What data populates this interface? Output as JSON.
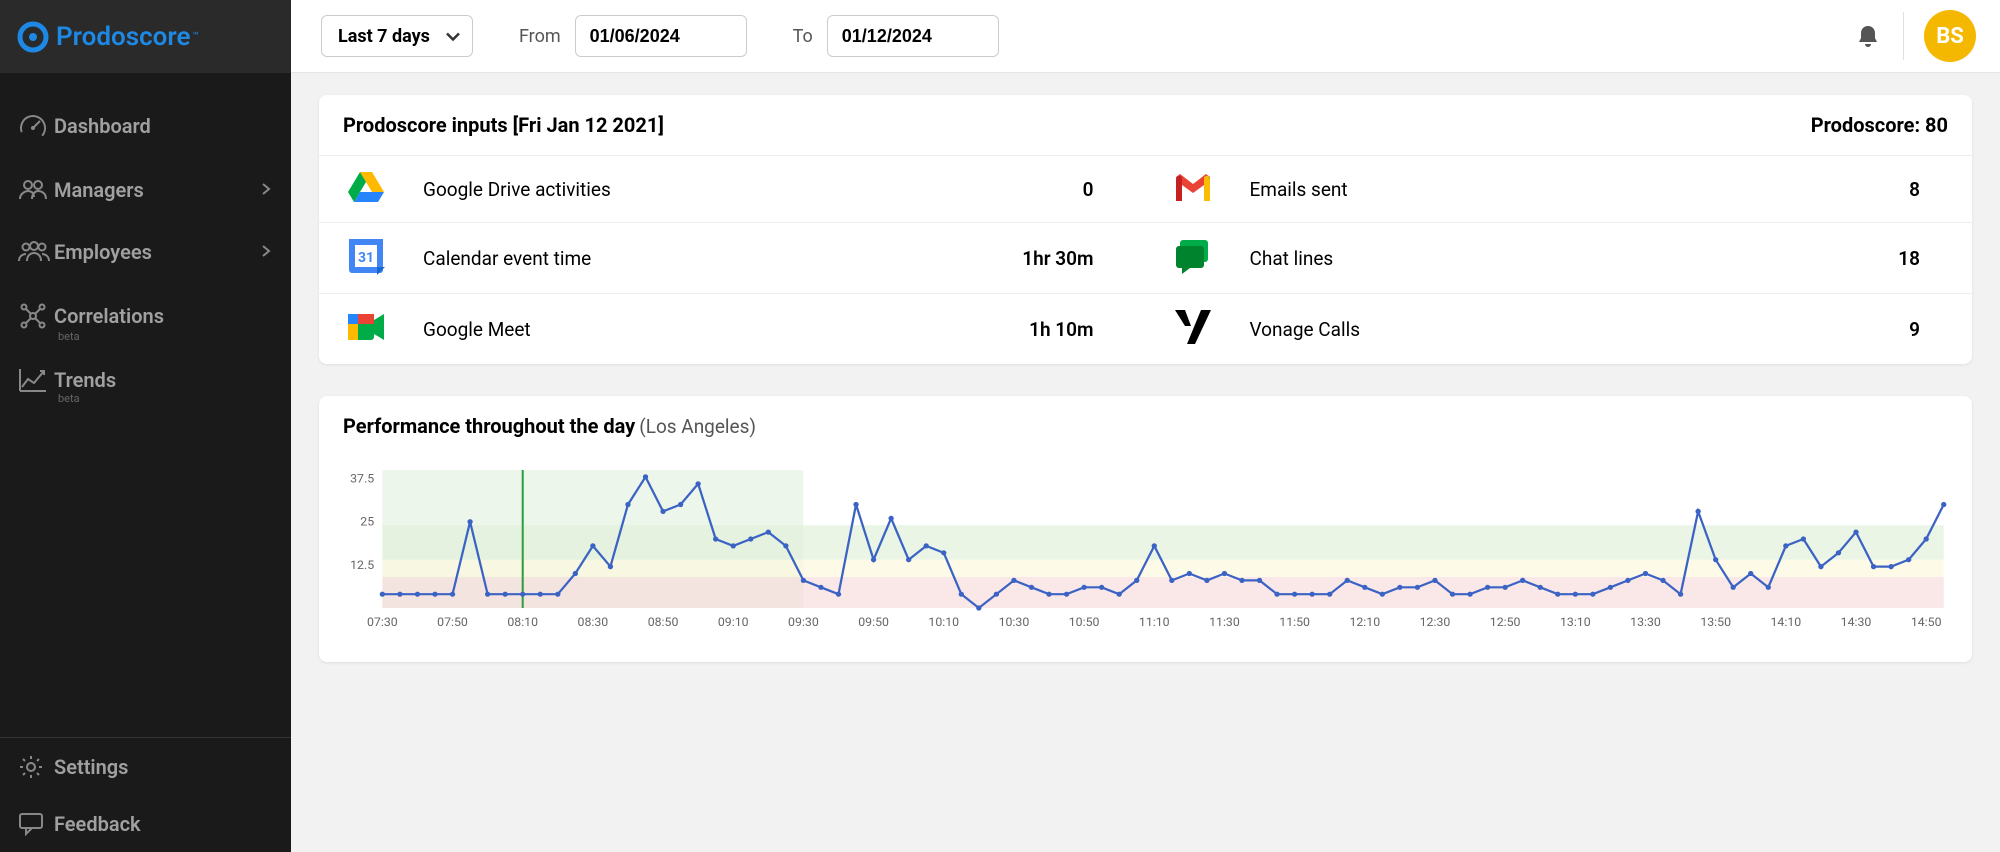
{
  "brand": {
    "name": "Prodoscore",
    "tm": "™"
  },
  "sidebar": {
    "nav": [
      {
        "label": "Dashboard",
        "icon": "dashboard",
        "chevron": false,
        "beta": false
      },
      {
        "label": "Managers",
        "icon": "managers",
        "chevron": true,
        "beta": false
      },
      {
        "label": "Employees",
        "icon": "employees",
        "chevron": true,
        "beta": false
      },
      {
        "label": "Correlations",
        "icon": "correlations",
        "chevron": false,
        "beta": true
      },
      {
        "label": "Trends",
        "icon": "trends",
        "chevron": false,
        "beta": true
      }
    ],
    "beta_label": "beta",
    "bottom": [
      {
        "label": "Settings",
        "icon": "settings"
      },
      {
        "label": "Feedback",
        "icon": "feedback"
      }
    ]
  },
  "topbar": {
    "range": "Last 7 days",
    "from_label": "From",
    "from_value": "01/06/2024",
    "to_label": "To",
    "to_value": "01/12/2024",
    "avatar": "BS"
  },
  "inputs_card": {
    "title": "Prodoscore inputs [Fri Jan 12 2021]",
    "score_label": "Prodoscore: 80",
    "rows": [
      [
        {
          "icon": "drive",
          "name": "Google Drive activities",
          "value": "0"
        },
        {
          "icon": "gmail",
          "name": "Emails sent",
          "value": "8"
        }
      ],
      [
        {
          "icon": "calendar",
          "name": "Calendar event time",
          "value": "1hr 30m"
        },
        {
          "icon": "chat",
          "name": "Chat lines",
          "value": "18"
        }
      ],
      [
        {
          "icon": "meet",
          "name": "Google Meet",
          "value": "1h 10m"
        },
        {
          "icon": "vonage",
          "name": "Vonage Calls",
          "value": "9"
        }
      ]
    ]
  },
  "perf_card": {
    "title": "Performance throughout the day",
    "location": "(Los Angeles)"
  },
  "chart_data": {
    "type": "line",
    "title": "Performance throughout the day (Los Angeles)",
    "xlabel": "",
    "ylabel": "",
    "ylim": [
      0,
      40
    ],
    "x_ticks": [
      "07:30",
      "07:50",
      "08:10",
      "08:30",
      "08:50",
      "09:10",
      "09:30",
      "09:50",
      "10:10",
      "10:30",
      "10:50",
      "11:10",
      "11:30",
      "11:50",
      "12:10",
      "12:30",
      "12:50",
      "13:10",
      "13:30",
      "13:50",
      "14:10",
      "14:30",
      "14:50"
    ],
    "y_ticks": [
      12.5,
      25,
      37.5
    ],
    "highlight_x": "08:10",
    "highlight_band": [
      "07:30",
      "09:30"
    ],
    "bands": [
      {
        "from": 14,
        "to": 24,
        "color": "#dff0d8"
      },
      {
        "from": 9,
        "to": 14,
        "color": "#fdf7dc"
      },
      {
        "from": 0,
        "to": 9,
        "color": "#f7dada"
      }
    ],
    "series": [
      {
        "name": "Performance",
        "color": "#3b63c4",
        "x": [
          "07:30",
          "07:35",
          "07:40",
          "07:45",
          "07:50",
          "07:55",
          "08:00",
          "08:05",
          "08:10",
          "08:15",
          "08:20",
          "08:25",
          "08:30",
          "08:35",
          "08:40",
          "08:45",
          "08:50",
          "08:55",
          "09:00",
          "09:05",
          "09:10",
          "09:15",
          "09:20",
          "09:25",
          "09:30",
          "09:35",
          "09:40",
          "09:45",
          "09:50",
          "09:55",
          "10:00",
          "10:05",
          "10:10",
          "10:15",
          "10:20",
          "10:25",
          "10:30",
          "10:35",
          "10:40",
          "10:45",
          "10:50",
          "10:55",
          "11:00",
          "11:05",
          "11:10",
          "11:15",
          "11:20",
          "11:25",
          "11:30",
          "11:35",
          "11:40",
          "11:45",
          "11:50",
          "11:55",
          "12:00",
          "12:05",
          "12:10",
          "12:15",
          "12:20",
          "12:25",
          "12:30",
          "12:35",
          "12:40",
          "12:45",
          "12:50",
          "12:55",
          "13:00",
          "13:05",
          "13:10",
          "13:15",
          "13:20",
          "13:25",
          "13:30",
          "13:35",
          "13:40",
          "13:45",
          "13:50",
          "13:55",
          "14:00",
          "14:05",
          "14:10",
          "14:15",
          "14:20",
          "14:25",
          "14:30",
          "14:35",
          "14:40",
          "14:45",
          "14:50",
          "14:55"
        ],
        "values": [
          4,
          4,
          4,
          4,
          4,
          25,
          4,
          4,
          4,
          4,
          4,
          10,
          18,
          12,
          30,
          38,
          28,
          30,
          36,
          20,
          18,
          20,
          22,
          18,
          8,
          6,
          4,
          30,
          14,
          26,
          14,
          18,
          16,
          4,
          0,
          4,
          8,
          6,
          4,
          4,
          6,
          6,
          4,
          8,
          18,
          8,
          10,
          8,
          10,
          8,
          8,
          4,
          4,
          4,
          4,
          8,
          6,
          4,
          6,
          6,
          8,
          4,
          4,
          6,
          6,
          8,
          6,
          4,
          4,
          4,
          6,
          8,
          10,
          8,
          4,
          28,
          14,
          6,
          10,
          6,
          18,
          20,
          12,
          16,
          22,
          12,
          12,
          14,
          20,
          30
        ]
      }
    ]
  }
}
